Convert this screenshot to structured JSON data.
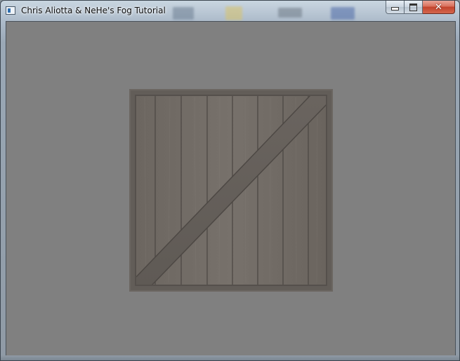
{
  "window": {
    "title": "Chris Aliotta & NeHe's Fog Tutorial",
    "icons": {
      "app": "app-icon",
      "minimize": "minimize-icon",
      "maximize": "maximize-icon",
      "close": "close-icon"
    },
    "close_glyph": "✕"
  },
  "scene": {
    "background_color": "#808080",
    "object": "wooden-crate"
  },
  "colors": {
    "close_button": "#c2432c",
    "crate_plank": "#6f6a64",
    "crate_frame": "#5e5854",
    "fog_gray": "#808080"
  }
}
